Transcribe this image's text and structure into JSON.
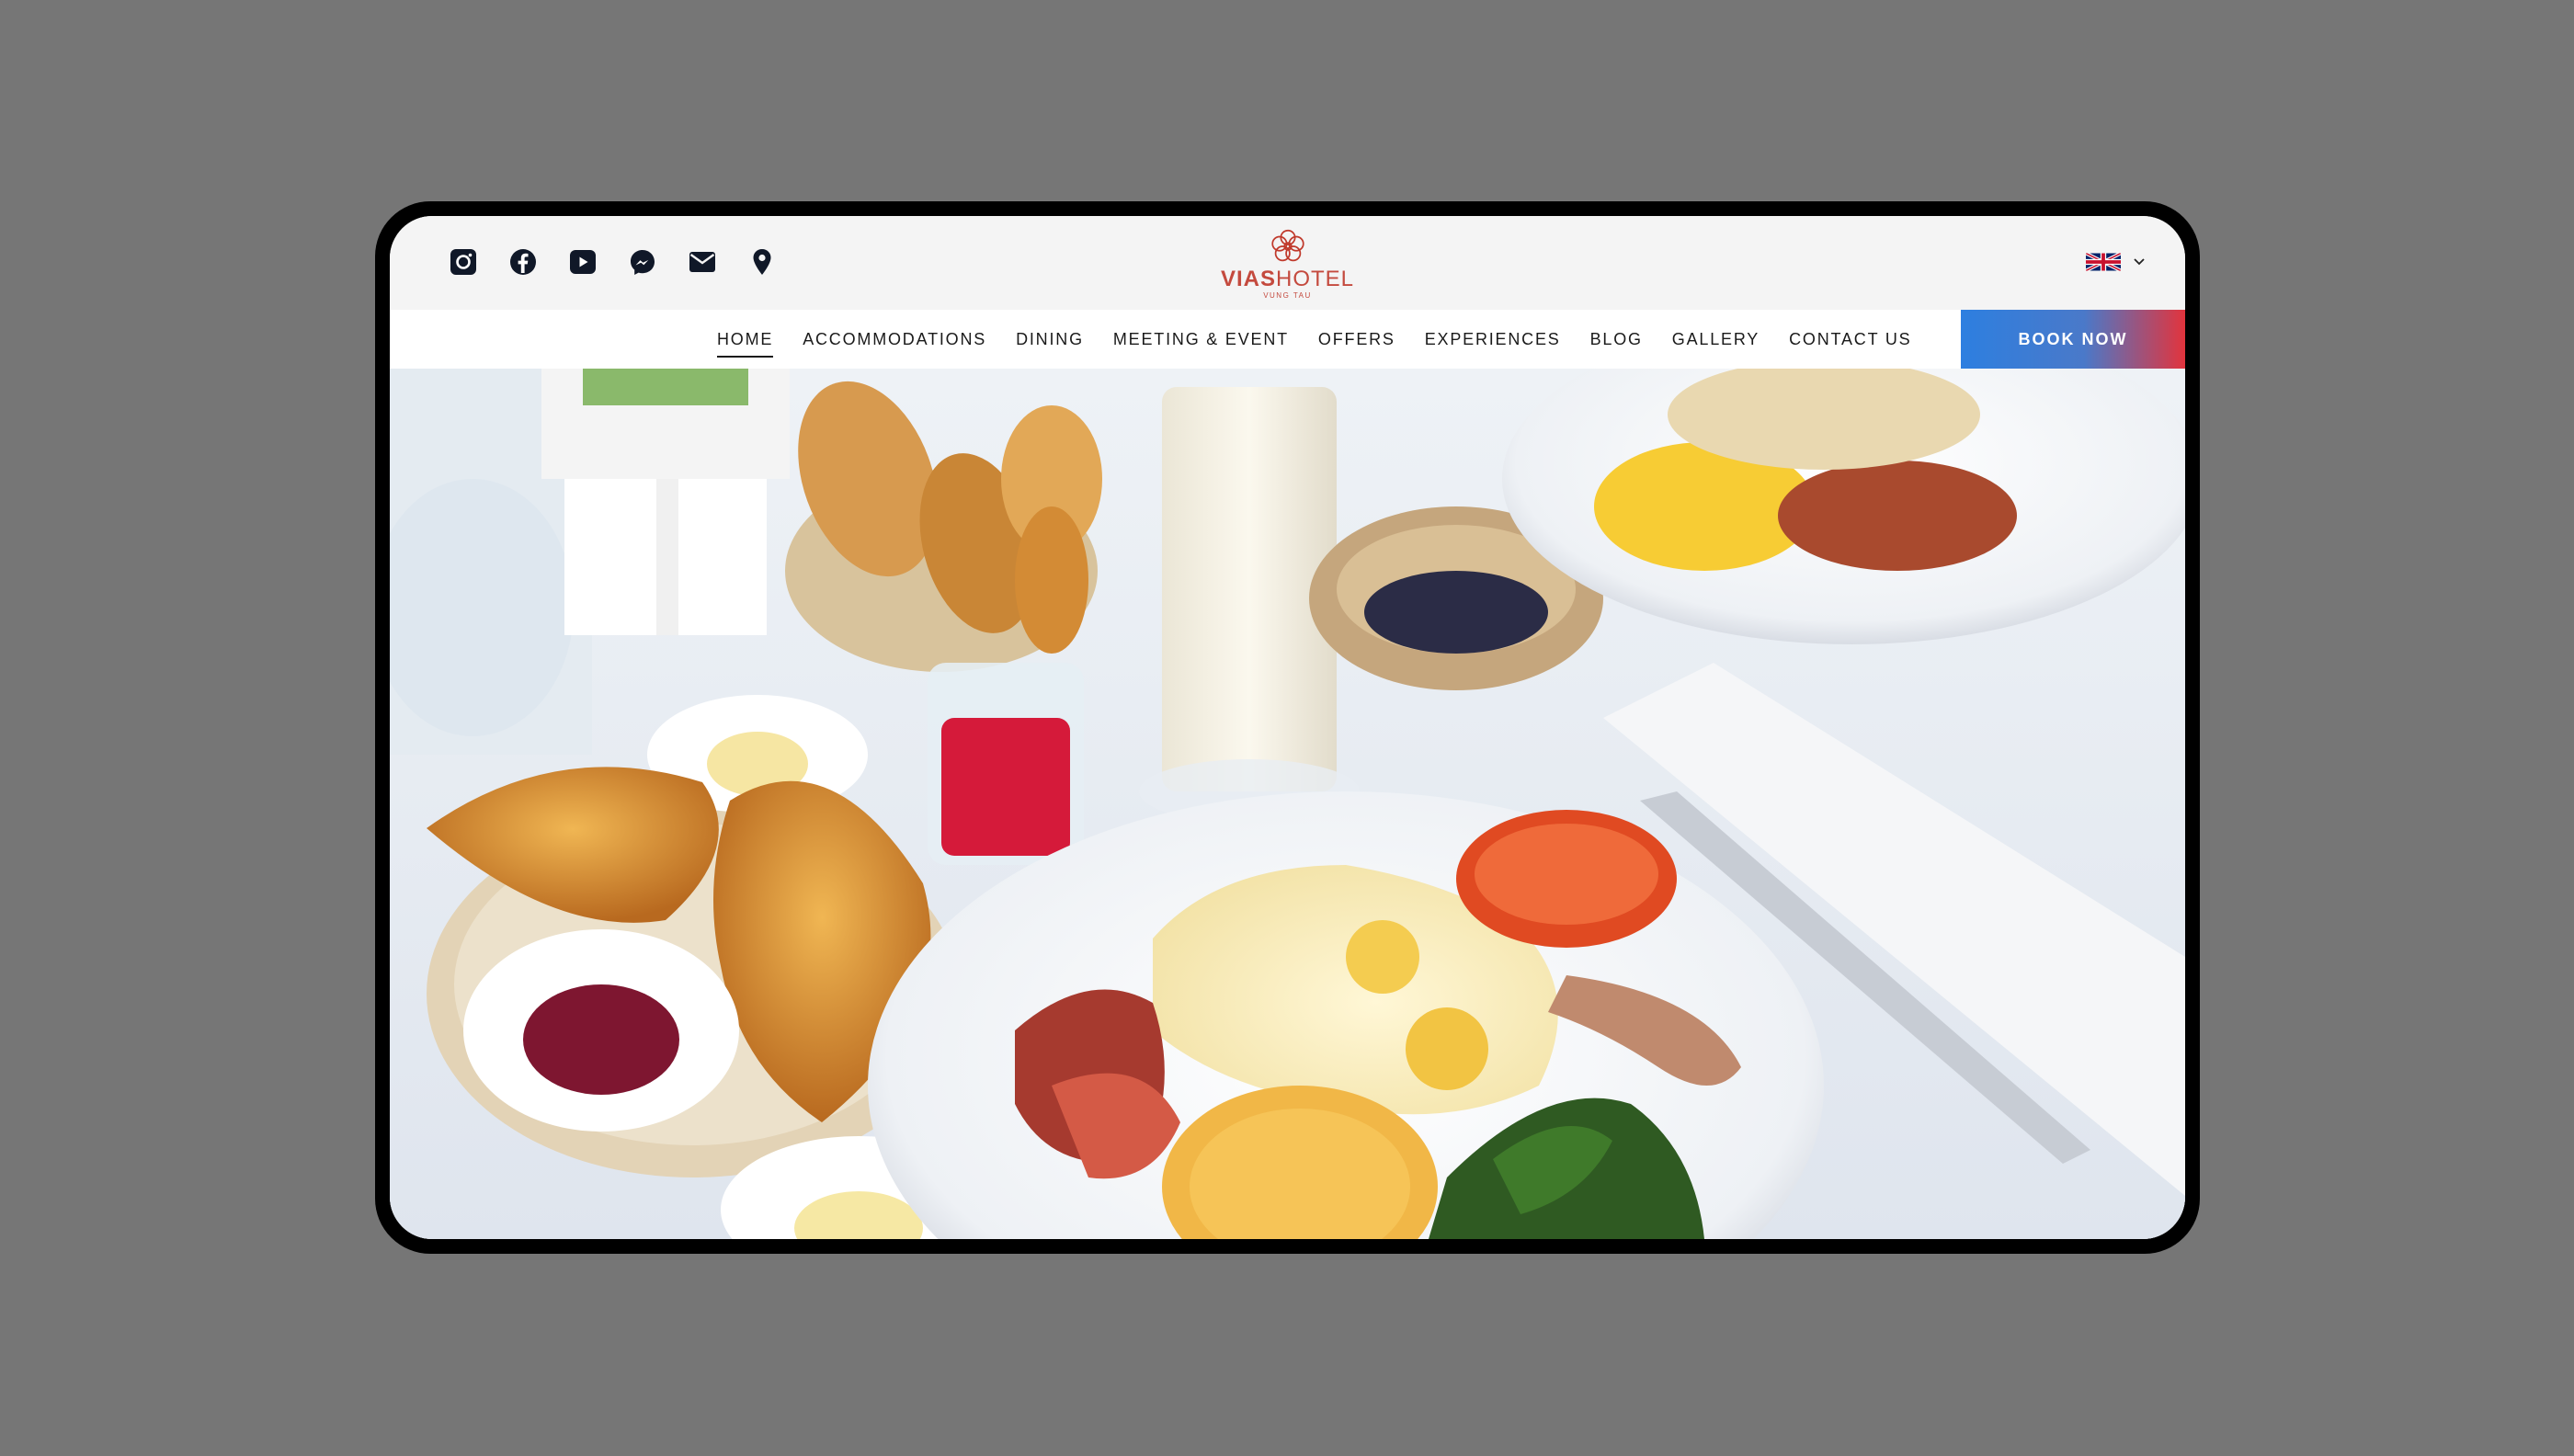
{
  "social_icons": [
    "instagram-icon",
    "facebook-icon",
    "youtube-icon",
    "messenger-icon",
    "mail-icon",
    "location-pin-icon"
  ],
  "logo": {
    "brand_bold": "VIAS",
    "brand_light": "HOTEL",
    "sub": "VUNG TAU",
    "color": "#c44a3e"
  },
  "language": {
    "flag": "uk-flag-icon",
    "chevron": "chevron-down-icon"
  },
  "nav": {
    "items": [
      {
        "label": "HOME",
        "active": true
      },
      {
        "label": "ACCOMMODATIONS",
        "active": false
      },
      {
        "label": "DINING",
        "active": false
      },
      {
        "label": "MEETING & EVENT",
        "active": false
      },
      {
        "label": "OFFERS",
        "active": false
      },
      {
        "label": "EXPERIENCES",
        "active": false
      },
      {
        "label": "BLOG",
        "active": false
      },
      {
        "label": "GALLERY",
        "active": false
      },
      {
        "label": "CONTACT US",
        "active": false
      }
    ],
    "book_label": "BOOK NOW",
    "book_gradient": [
      "#2d7fe0",
      "#e2343d"
    ]
  }
}
